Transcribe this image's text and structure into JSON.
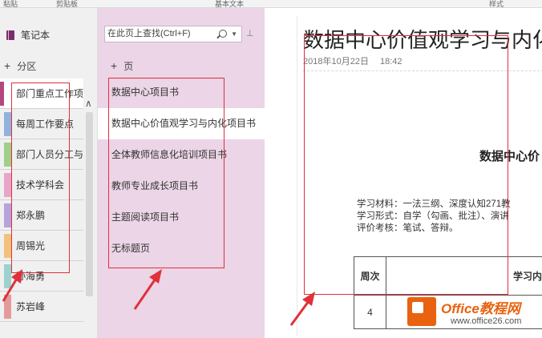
{
  "ribbon": {
    "items": [
      "粘贴",
      "剪贴板",
      "基本文本",
      "样式"
    ]
  },
  "notebook": {
    "title": "笔记本"
  },
  "sections": {
    "add_label": "分区",
    "items": [
      {
        "label": "部门重点工作项",
        "color": "#b5477d"
      },
      {
        "label": "每周工作要点",
        "color": "#8fb3de"
      },
      {
        "label": "部门人员分工与",
        "color": "#9fcf8a"
      },
      {
        "label": "技术学科会",
        "color": "#e7a6c8"
      },
      {
        "label": "郑永鹏",
        "color": "#b7a3db"
      },
      {
        "label": "周锡光",
        "color": "#f2c27b"
      },
      {
        "label": "孙海勇",
        "color": "#9bd2cf"
      },
      {
        "label": "苏岩峰",
        "color": "#e59a9a"
      }
    ]
  },
  "search": {
    "placeholder": "在此页上查找(Ctrl+F)",
    "value": "在此页上查找(Ctrl+F)"
  },
  "pages": {
    "add_label": "页",
    "items": [
      {
        "label": "数据中心项目书"
      },
      {
        "label": "数据中心价值观学习与内化项目书"
      },
      {
        "label": "全体教师信息化培训项目书"
      },
      {
        "label": "教师专业成长项目书"
      },
      {
        "label": "主题阅读项目书"
      },
      {
        "label": "无标题页"
      }
    ]
  },
  "page": {
    "title": "数据中心价值观学习与内化",
    "date": "2018年10月22日",
    "time": "18:42",
    "heading": "数据中心价",
    "lines": [
      "学习材料：一法三纲、深度认知271教",
      "学习形式：自学（勾画、批注）、演讲",
      "评价考核：笔试、答辩。"
    ],
    "table": {
      "col1_header": "周次",
      "col2_header": "学习内",
      "row1_col1": "4"
    }
  },
  "watermark": {
    "title": "Office教程网",
    "url": "www.office26.com"
  },
  "colors": {
    "annotation": "#e0303a",
    "pages_bg": "#ebd5e6",
    "accent": "#b5477d"
  }
}
